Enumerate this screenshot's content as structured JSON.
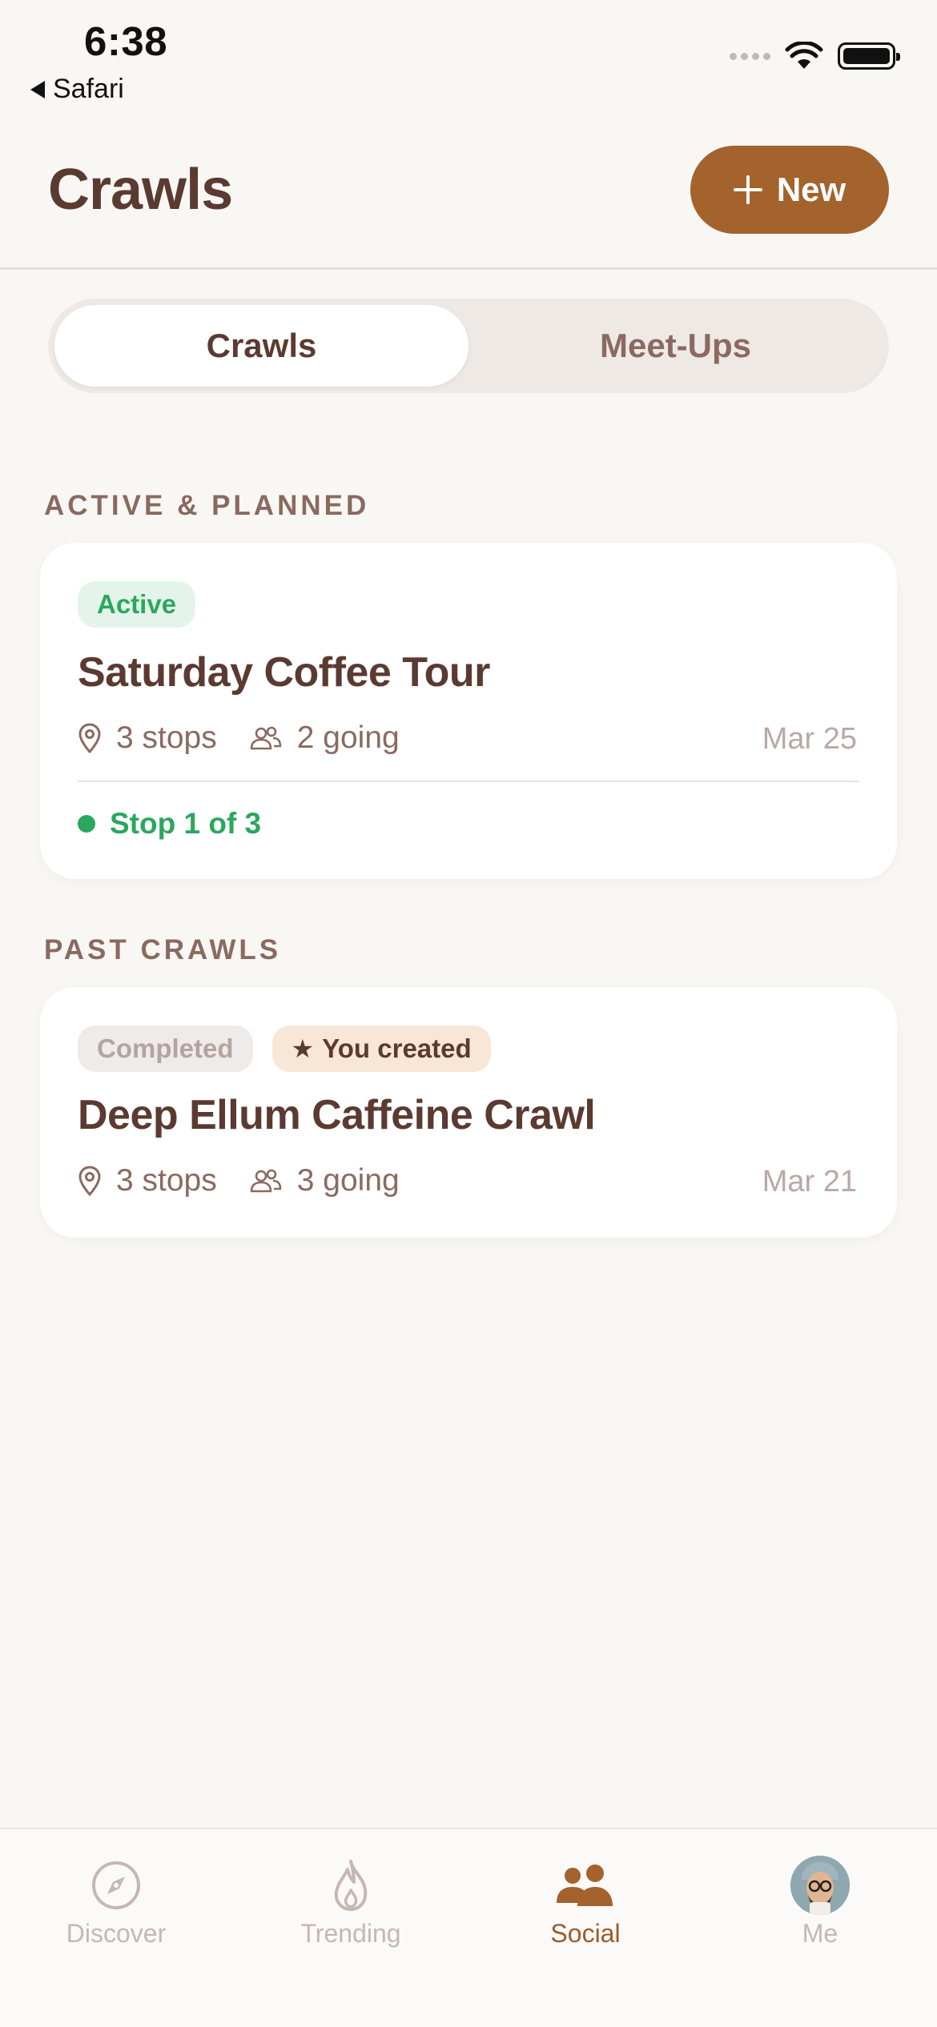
{
  "status_bar": {
    "time": "6:38",
    "back_label": "Safari"
  },
  "header": {
    "title": "Crawls",
    "new_button_label": "New"
  },
  "segments": [
    {
      "label": "Crawls",
      "selected": true
    },
    {
      "label": "Meet-Ups",
      "selected": false
    }
  ],
  "sections": {
    "active": {
      "title": "ACTIVE & PLANNED",
      "card": {
        "badge": "Active",
        "title": "Saturday Coffee Tour",
        "stops": "3 stops",
        "going": "2 going",
        "date": "Mar 25",
        "progress": "Stop 1 of 3"
      }
    },
    "past": {
      "title": "PAST CRAWLS",
      "card": {
        "badge_status": "Completed",
        "badge_creator": "You created",
        "title": "Deep Ellum Caffeine Crawl",
        "stops": "3 stops",
        "going": "3 going",
        "date": "Mar 21"
      }
    }
  },
  "tabbar": {
    "items": [
      {
        "label": "Discover",
        "icon": "compass-icon",
        "selected": false
      },
      {
        "label": "Trending",
        "icon": "flame-icon",
        "selected": false
      },
      {
        "label": "Social",
        "icon": "people-icon",
        "selected": true
      },
      {
        "label": "Me",
        "icon": "avatar",
        "selected": false
      }
    ]
  },
  "colors": {
    "brand": "#a4622c",
    "title_text": "#5b3a31",
    "active_green": "#2aa85d",
    "muted_text": "#8a6a60",
    "background": "#f9f7f4"
  }
}
